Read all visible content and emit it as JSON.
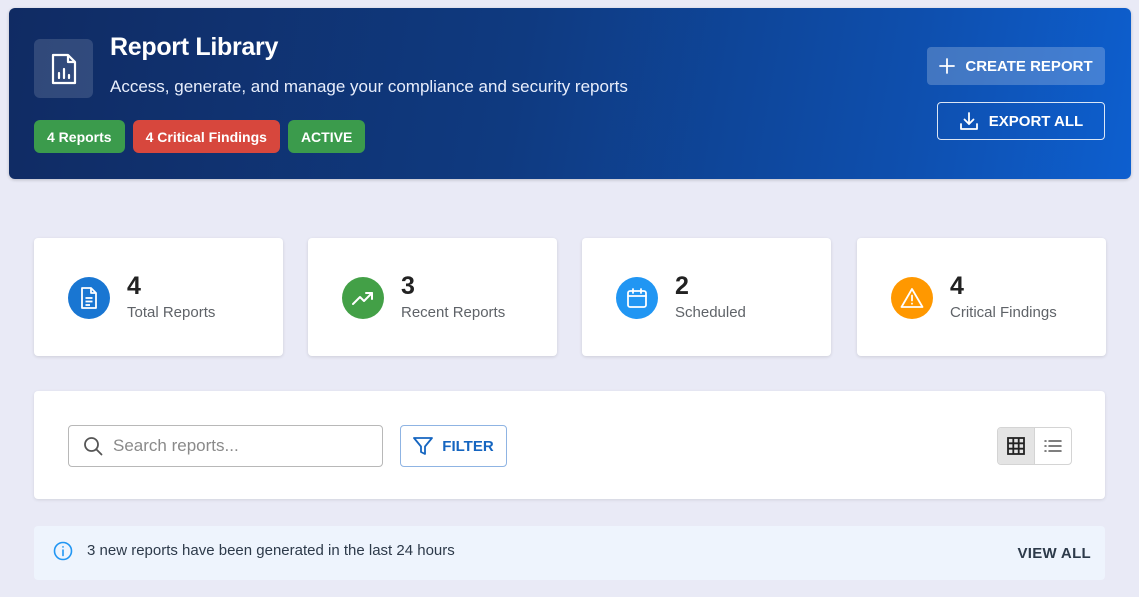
{
  "header": {
    "title": "Report Library",
    "subtitle": "Access, generate, and manage your compliance and security reports",
    "chips": [
      {
        "label": "4 Reports",
        "color": "#3b9b4c"
      },
      {
        "label": "4 Critical Findings",
        "color": "#d7473d"
      },
      {
        "label": "ACTIVE",
        "color": "#3b9b4c"
      }
    ],
    "create_label": "CREATE REPORT",
    "export_label": "EXPORT ALL"
  },
  "stats": [
    {
      "value": "4",
      "label": "Total Reports",
      "icon": "document-icon",
      "color": "#1976d2"
    },
    {
      "value": "3",
      "label": "Recent Reports",
      "icon": "trending-up-icon",
      "color": "#43a047"
    },
    {
      "value": "2",
      "label": "Scheduled",
      "icon": "calendar-icon",
      "color": "#2196f3"
    },
    {
      "value": "4",
      "label": "Critical Findings",
      "icon": "warning-icon",
      "color": "#ff9800"
    }
  ],
  "toolbar": {
    "search_placeholder": "Search reports...",
    "filter_label": "FILTER",
    "view_mode": "grid"
  },
  "alert": {
    "message": "3 new reports have been generated in the last 24 hours",
    "action_label": "VIEW ALL"
  }
}
